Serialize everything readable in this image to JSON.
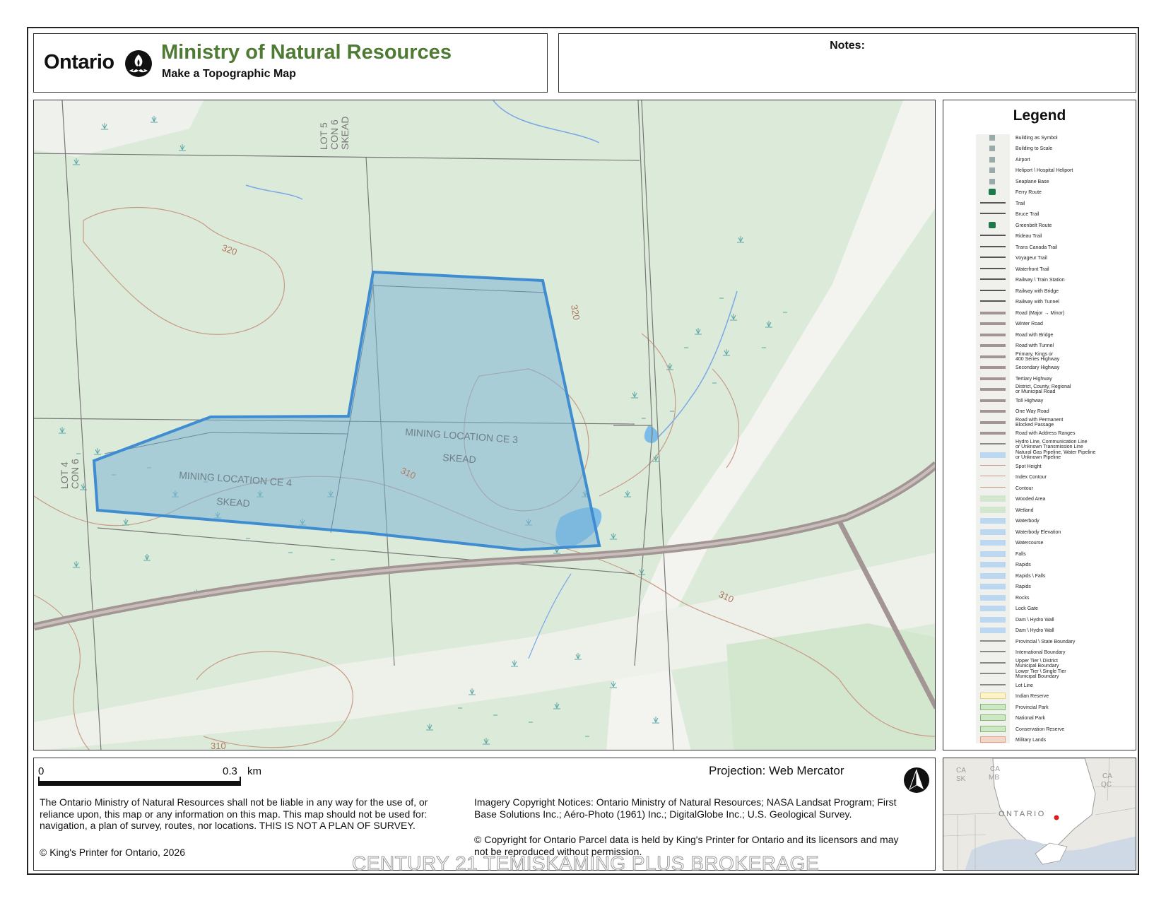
{
  "header": {
    "ontario_wordmark": "Ontario",
    "ministry_title": "Ministry of Natural Resources",
    "subtitle": "Make a Topographic Map",
    "brand_color": "#4e7a33"
  },
  "notes": {
    "label": "Notes:"
  },
  "map": {
    "lot_labels": {
      "lot5": [
        "LOT 5",
        "CON 6",
        "SKEAD"
      ],
      "lot4": [
        "LOT 4",
        "CON 6"
      ]
    },
    "mining_locations": [
      {
        "line1": "MINING LOCATION CE 3",
        "line2": "SKEAD"
      },
      {
        "line1": "MINING LOCATION CE 4",
        "line2": "SKEAD"
      }
    ],
    "contours": [
      "320",
      "320",
      "310",
      "310",
      "310"
    ],
    "colors": {
      "land": "#dcebd9",
      "open_area": "#f4f4f0",
      "road": "#a39593",
      "parcel_outline": "#3f8dd0",
      "parcel_fill": "#7fb4d6",
      "water": "#7bbde8",
      "contour": "#c89a86",
      "wetland": "#5aa6a6"
    }
  },
  "legend": {
    "title": "Legend",
    "items": [
      "Building as Symbol",
      "Building to Scale",
      "Airport",
      "Heliport \\ Hospital Heliport",
      "Seaplane Base",
      "Ferry Route",
      "Trail",
      "Bruce Trail",
      "Greenbelt Route",
      "Rideau Trail",
      "Trans Canada Trail",
      "Voyageur Trail",
      "Waterfront Trail",
      "Railway \\ Train Station",
      "Railway with Bridge",
      "Railway with Tunnel",
      "Road (Major → Minor)",
      "Winter Road",
      "Road with Bridge",
      "Road with Tunnel",
      "Primary, Kings or\n400 Series Highway",
      "Secondary Highway",
      "Tertiary Highway",
      "District, County, Regional\nor Municipal Road",
      "Toll Highway",
      "One Way Road",
      "Road with Permanent\nBlocked Passage",
      "Road with Address Ranges",
      "Hydro Line, Communication Line\nor Unknown Transmission Line",
      "Natural Gas Pipeline, Water Pipeline\nor Unknown Pipeline",
      "Spot Height",
      "Index Contour",
      "Contour",
      "Wooded Area",
      "Wetland",
      "Waterbody",
      "Waterbody Elevation",
      "Watercourse",
      "Falls",
      "Rapids",
      "Rapids \\ Falls",
      "Rapids",
      "Rocks",
      "Lock Gate",
      "Dam \\ Hydro Wall",
      "Dam \\ Hydro Wall",
      "Provincial \\ State Boundary",
      "International Boundary",
      "Upper Tier \\ District\nMunicipal Boundary",
      "Lower Tier \\ Single Tier\nMunicipal Boundary",
      "Lot Line",
      "Indian Reserve",
      "Provincial Park",
      "National Park",
      "Conservation Reserve",
      "Military Lands"
    ]
  },
  "scale_bar": {
    "start": "0",
    "end": "0.3",
    "unit": "km"
  },
  "projection": "Projection: Web Mercator",
  "disclaimer": "The Ontario Ministry of Natural Resources shall not be liable in any way for the use of, or reliance upon, this map or any information on this map.  This map should not be used for: navigation, a plan of survey, routes, nor locations. THIS IS NOT A PLAN OF SURVEY.",
  "copyright": "© King's Printer for Ontario,  2026",
  "imagery_notice": "Imagery Copyright Notices: Ontario Ministry of Natural Resources; NASA Landsat Program; First Base Solutions Inc.; Aéro-Photo (1961) Inc.; DigitalGlobe Inc.; U.S. Geological Survey.",
  "parcel_notice": "© Copyright for Ontario Parcel data is held by King's Printer for Ontario and its licensors and may not be reproduced without permission.",
  "watermark": "CENTURY 21 TEMISKAMING PLUS BROKERAGE",
  "inset": {
    "province_label": "ONTARIO",
    "neighbours": [
      {
        "line1": "CA",
        "line2": "SK"
      },
      {
        "line1": "CA",
        "line2": "MB"
      },
      {
        "line1": "CA",
        "line2": "QC"
      }
    ],
    "marker_color": "#d62020"
  }
}
